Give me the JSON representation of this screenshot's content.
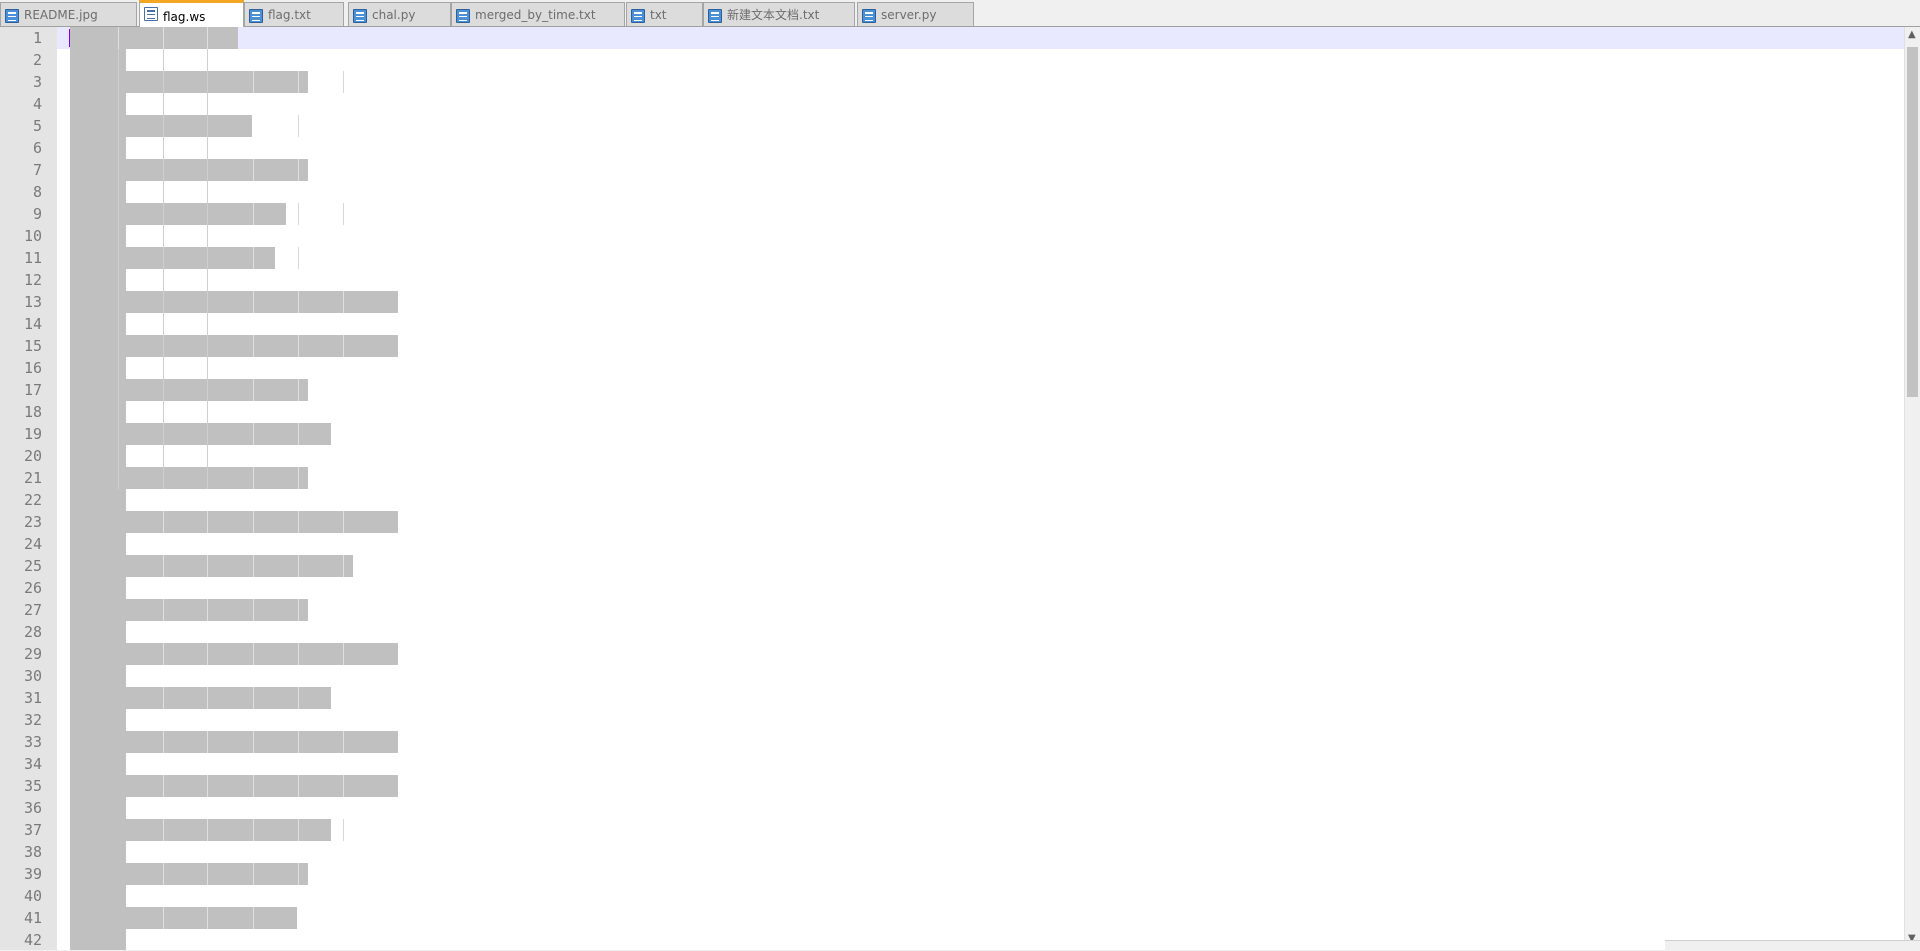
{
  "tabs": [
    {
      "label": "README.jpg",
      "active": false
    },
    {
      "label": "flag.ws",
      "active": true
    },
    {
      "label": "flag.txt",
      "active": false
    },
    {
      "label": "chal.py",
      "active": false
    },
    {
      "label": "merged_by_time.txt",
      "active": false
    },
    {
      "label": "txt",
      "active": false
    },
    {
      "label": "新建文本文档.txt",
      "active": false
    },
    {
      "label": "server.py",
      "active": false
    }
  ],
  "editor": {
    "line_numbers": [
      "1",
      "2",
      "3",
      "4",
      "5",
      "6",
      "7",
      "8",
      "9",
      "10",
      "11",
      "12",
      "13",
      "14",
      "15",
      "16",
      "17",
      "18",
      "19",
      "20",
      "21",
      "22",
      "23",
      "24",
      "25",
      "26",
      "27",
      "28",
      "29",
      "30",
      "31",
      "32",
      "33",
      "34",
      "35",
      "36",
      "37",
      "38",
      "39",
      "40",
      "41",
      "42"
    ],
    "current_line": 1
  },
  "icons": {
    "file": "file-icon",
    "pin": "pin-icon",
    "close": "close-icon",
    "scroll_up": "chevron-up-icon",
    "scroll_down": "chevron-down-icon"
  },
  "colors": {
    "whitespace_marker": "#c0c0c0",
    "current_line": "#e8e8ff",
    "active_tab_accent": "#f5a623",
    "caret": "#8000ff"
  }
}
